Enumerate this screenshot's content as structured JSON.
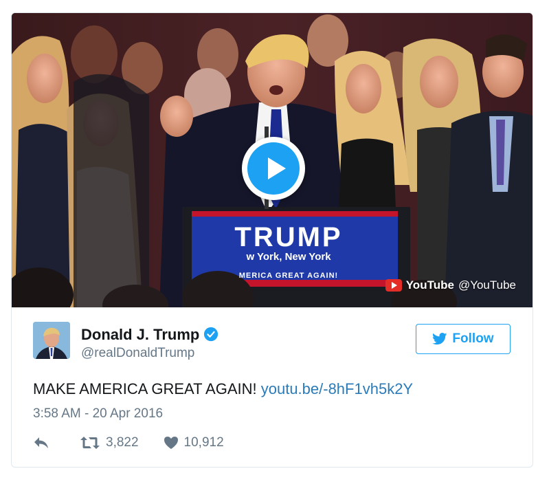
{
  "media": {
    "podium_line1": "TRUMP",
    "podium_line2": "w York, New York",
    "podium_line3": "MERICA GREAT AGAIN!",
    "youtube_name": "YouTube",
    "youtube_handle": "@YouTube"
  },
  "author": {
    "display_name": "Donald J. Trump",
    "handle": "@realDonaldTrump",
    "verified": true
  },
  "follow_label": "Follow",
  "tweet": {
    "text": "MAKE AMERICA GREAT AGAIN!",
    "link": "youtu.be/-8hF1vh5k2Y",
    "timestamp": "3:58 AM - 20 Apr 2016"
  },
  "stats": {
    "retweets": "3,822",
    "likes": "10,912"
  },
  "colors": {
    "accent": "#1da1f2",
    "link": "#2b7bb9",
    "muted": "#657786",
    "border": "#e1e8ed",
    "youtube_red": "#e52d27"
  },
  "icons": {
    "play": "play-icon",
    "youtube": "youtube-logo-icon",
    "verified": "verified-badge-icon",
    "follow": "twitter-bird-icon",
    "reply": "reply-icon",
    "retweet": "retweet-icon",
    "like": "heart-icon"
  }
}
